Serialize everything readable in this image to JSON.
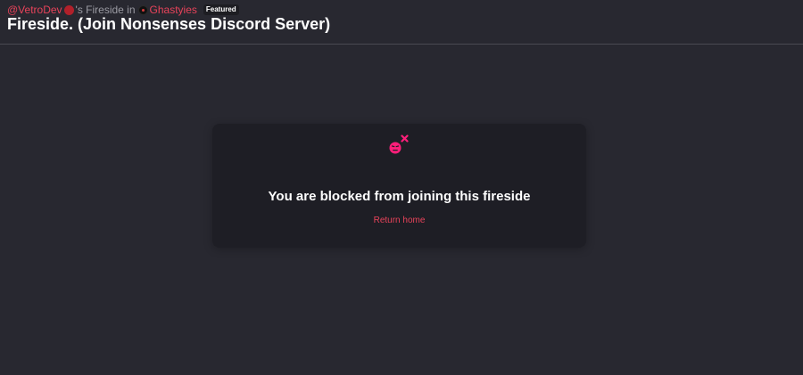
{
  "header": {
    "user_handle": "@VetroDev",
    "fireside_suffix": "'s Fireside in",
    "community_name": "Ghastyies",
    "featured_badge": "Featured",
    "title": "Fireside. (Join Nonsenses Discord Server)"
  },
  "blocked_card": {
    "icon": "blocked-face-icon",
    "message": "You are blocked from joining this fireside",
    "return_link": "Return home"
  },
  "colors": {
    "background": "#282830",
    "card": "#1e1e25",
    "accent_link": "#e8435a",
    "icon_pink": "#ff1e7a"
  }
}
